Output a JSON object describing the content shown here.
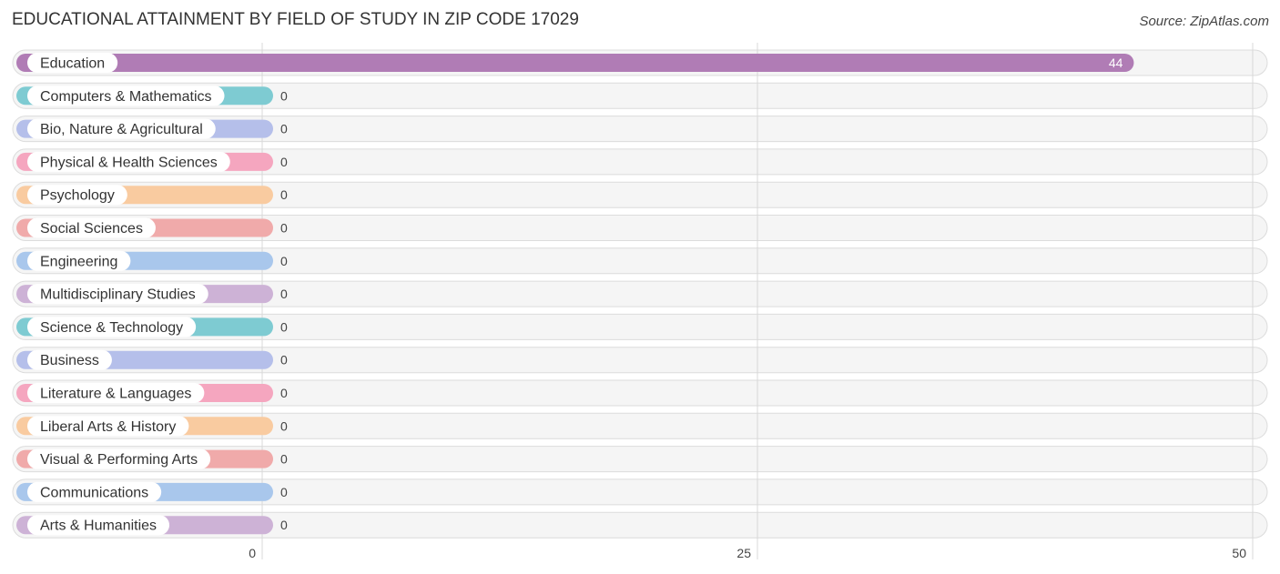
{
  "chart_data": {
    "type": "bar",
    "orientation": "horizontal",
    "title": "EDUCATIONAL ATTAINMENT BY FIELD OF STUDY IN ZIP CODE 17029",
    "source": "Source: ZipAtlas.com",
    "xlabel": "",
    "ylabel": "",
    "xlim": [
      0,
      50
    ],
    "xticks": [
      0,
      25,
      50
    ],
    "grid": true,
    "categories": [
      "Education",
      "Computers & Mathematics",
      "Bio, Nature & Agricultural",
      "Physical & Health Sciences",
      "Psychology",
      "Social Sciences",
      "Engineering",
      "Multidisciplinary Studies",
      "Science & Technology",
      "Business",
      "Literature & Languages",
      "Liberal Arts & History",
      "Visual & Performing Arts",
      "Communications",
      "Arts & Humanities"
    ],
    "values": [
      44,
      0,
      0,
      0,
      0,
      0,
      0,
      0,
      0,
      0,
      0,
      0,
      0,
      0,
      0
    ],
    "colors": [
      "#b07cb5",
      "#7ecbd2",
      "#b5bfea",
      "#f5a6bf",
      "#f9cba0",
      "#f0aaaa",
      "#a9c7ec",
      "#cdb2d6",
      "#7ecbd2",
      "#b5bfea",
      "#f5a6bf",
      "#f9cba0",
      "#f0aaaa",
      "#a9c7ec",
      "#cdb2d6"
    ]
  }
}
